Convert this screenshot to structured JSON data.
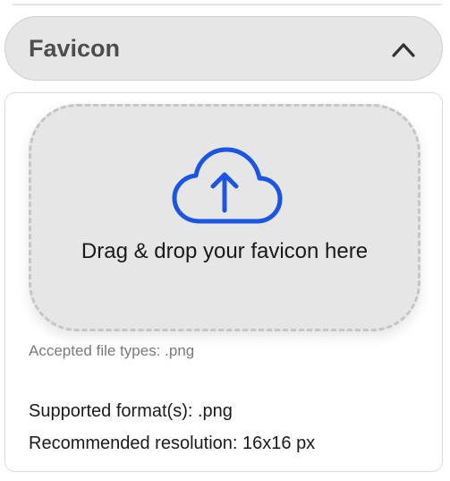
{
  "section": {
    "title": "Favicon",
    "expanded": true,
    "toggle_icon": "chevron-up-icon"
  },
  "dropzone": {
    "icon": "cloud-upload-icon",
    "text": "Drag & drop your favicon here",
    "accent_color": "#1a55e3"
  },
  "accepted_types": "Accepted file types: .png",
  "info": {
    "supported_formats": "Supported format(s): .png",
    "recommended_resolution": "Recommended resolution: 16x16 px"
  }
}
